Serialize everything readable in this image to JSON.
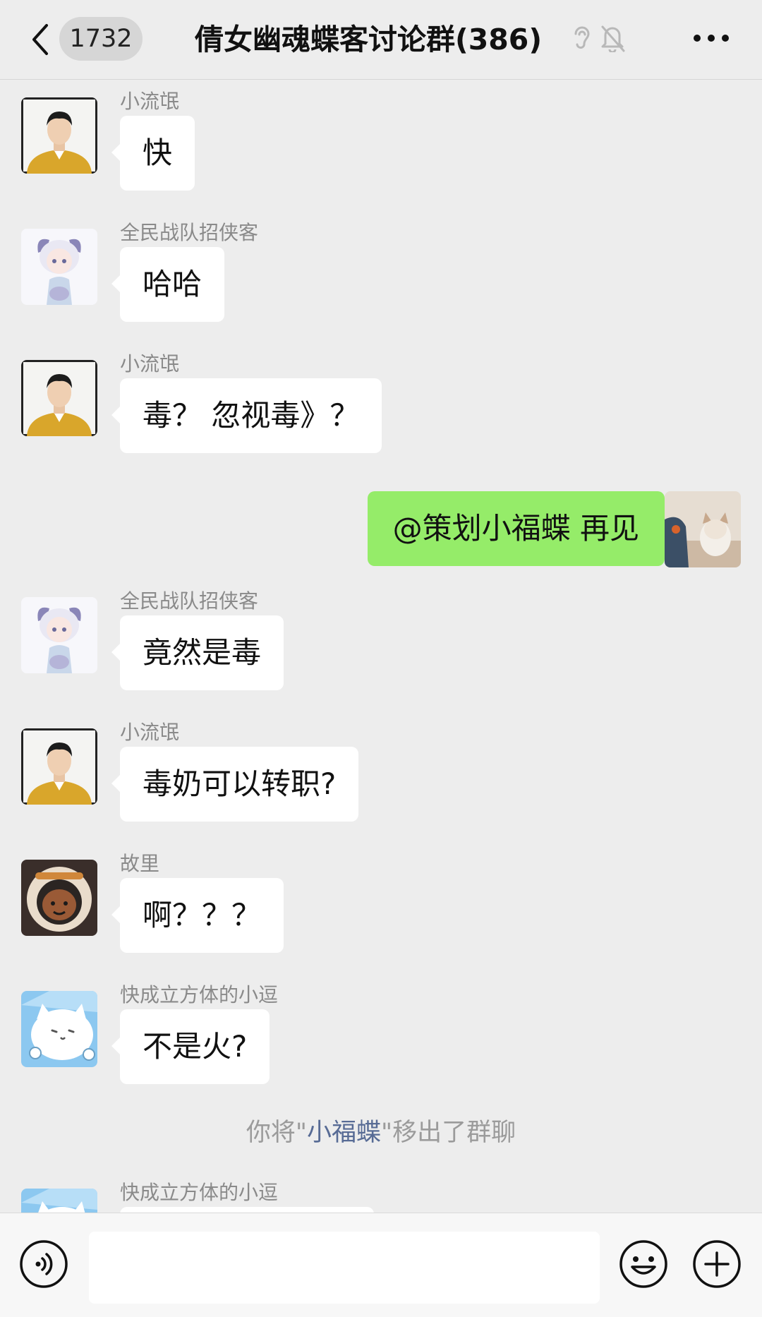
{
  "header": {
    "back_badge": "1732",
    "title": "倩女幽魂蝶客讨论群(386)"
  },
  "messages": [
    {
      "sender": "小流氓",
      "text": "快"
    },
    {
      "sender": "全民战队招侠客",
      "text": "哈哈"
    },
    {
      "sender": "小流氓",
      "text": "毒？ 忽视毒》？"
    },
    {
      "sender": "",
      "text": "@策划小福蝶 再见"
    },
    {
      "sender": "全民战队招侠客",
      "text": "竟然是毒"
    },
    {
      "sender": "小流氓",
      "text": "毒奶可以转职?"
    },
    {
      "sender": "故里",
      "text": "啊？？？"
    },
    {
      "sender": "快成立方体的小逗",
      "text": "不是火?"
    },
    {
      "sender": "快成立方体的小逗",
      "text": ""
    }
  ],
  "system_message": {
    "prefix": "你将\"",
    "name": "小福蝶",
    "suffix": "\"移出了群聊"
  },
  "input": {
    "value": "",
    "placeholder": ""
  },
  "colors": {
    "background": "#ededed",
    "bubble_mine": "#95ec69",
    "bubble_other": "#ffffff",
    "link_name": "#576b95"
  }
}
